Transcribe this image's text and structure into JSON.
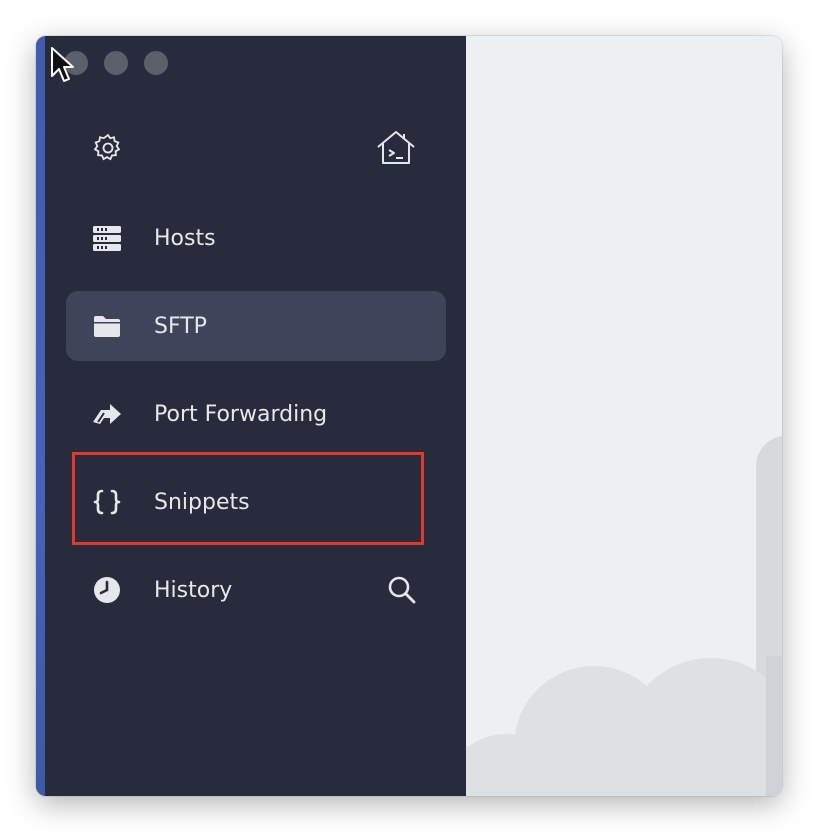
{
  "window": {
    "traffic_lights": [
      "close",
      "minimize",
      "maximize"
    ]
  },
  "sidebar": {
    "top_icons": {
      "settings": "gear-icon",
      "local_terminal": "terminal-home-icon"
    },
    "items": [
      {
        "label": "Hosts",
        "icon": "hosts-icon",
        "active": false
      },
      {
        "label": "SFTP",
        "icon": "folder-icon",
        "active": true
      },
      {
        "label": "Port Forwarding",
        "icon": "port-forwarding-icon",
        "active": false
      },
      {
        "label": "Snippets",
        "icon": "snippets-icon",
        "active": false,
        "highlighted": true
      },
      {
        "label": "History",
        "icon": "history-icon",
        "active": false
      }
    ],
    "history_action_icon": "search-icon"
  },
  "colors": {
    "sidebar_bg": "#282b3b",
    "active_item_bg": "#40445a",
    "highlight_border": "#e03a2c",
    "main_bg": "#edf0f2"
  }
}
